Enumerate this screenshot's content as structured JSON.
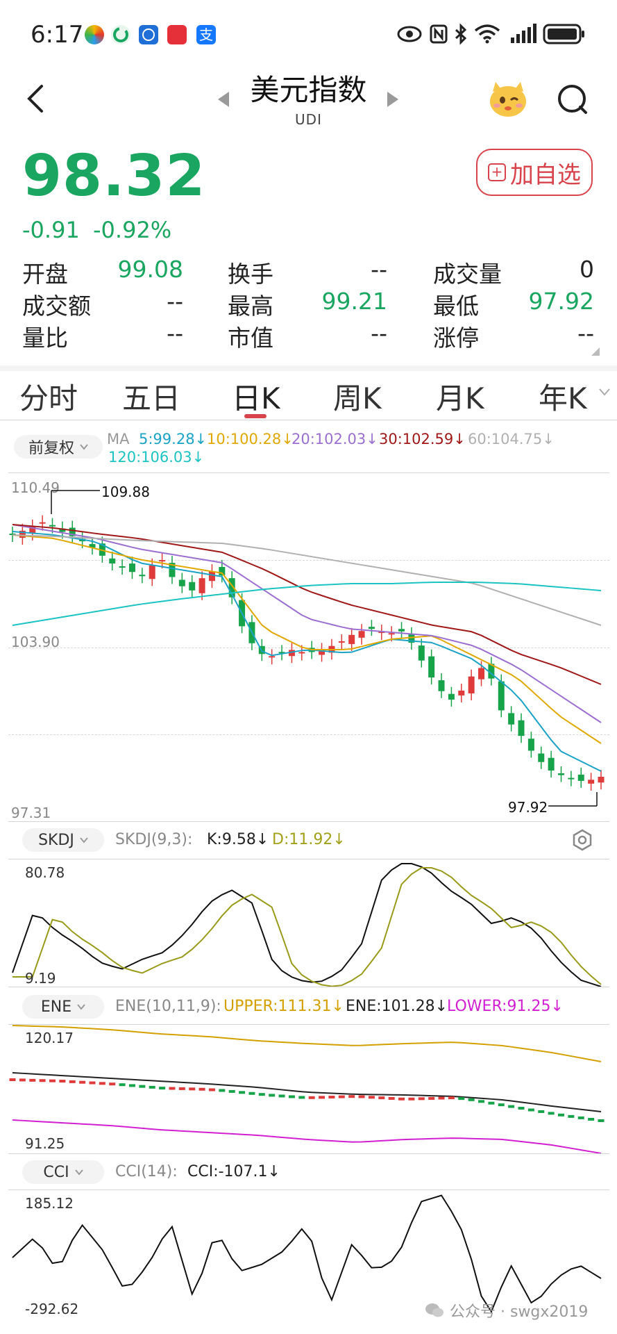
{
  "status_bar": {
    "time": "6:17"
  },
  "header": {
    "title": "美元指数",
    "code": "UDI"
  },
  "quote": {
    "price": "98.32",
    "change": "-0.91",
    "change_pct": "-0.92%",
    "add_button": "加自选",
    "stats": [
      {
        "label": "开盘",
        "value": "99.08",
        "color": "green"
      },
      {
        "label": "换手",
        "value": "--",
        "color": "dark"
      },
      {
        "label": "成交量",
        "value": "0",
        "color": "dark"
      },
      {
        "label": "成交额",
        "value": "--",
        "color": "dark"
      },
      {
        "label": "最高",
        "value": "99.21",
        "color": "green"
      },
      {
        "label": "最低",
        "value": "97.92",
        "color": "green"
      },
      {
        "label": "量比",
        "value": "--",
        "color": "dark"
      },
      {
        "label": "市值",
        "value": "--",
        "color": "dark"
      },
      {
        "label": "涨停",
        "value": "--",
        "color": "dark"
      }
    ]
  },
  "tabs": [
    "分时",
    "五日",
    "日K",
    "周K",
    "月K",
    "年K"
  ],
  "active_tab": "日K",
  "main_chart": {
    "adjust_label": "前复权",
    "ma_label": "MA",
    "ma_items": [
      {
        "text": "5:99.28↓",
        "color": "#1ba3c6"
      },
      {
        "text": "10:100.28↓",
        "color": "#e0a800"
      },
      {
        "text": "20:102.03↓",
        "color": "#9b6fd0"
      },
      {
        "text": "30:102.59↓",
        "color": "#a01818"
      },
      {
        "text": "60:104.75↓",
        "color": "#b0b0b0"
      },
      {
        "text": "120:106.03↓",
        "color": "#1cc3c3"
      }
    ],
    "y_top": "110.49",
    "y_mid": "103.90",
    "y_bottom": "97.31",
    "high_marker": "109.88",
    "low_marker": "97.92"
  },
  "skdj": {
    "name": "SKDJ",
    "params": "SKDJ(9,3):",
    "k": "K:9.58↓",
    "d": "D:11.92↓",
    "y_top": "80.78",
    "y_bottom": "9.19"
  },
  "ene": {
    "name": "ENE",
    "params": "ENE(10,11,9):",
    "upper": "UPPER:111.31↓",
    "ene": "ENE:101.28↓",
    "lower": "LOWER:91.25↓",
    "y_top": "120.17",
    "y_bottom": "91.25"
  },
  "cci": {
    "name": "CCI",
    "params": "CCI(14):",
    "value": "CCI:-107.1↓",
    "y_top": "185.12",
    "y_bottom": "-292.62"
  },
  "watermark": "公众号 · swgx2019",
  "colors": {
    "up": "#e03b3b",
    "down": "#16a34a",
    "accent": "#d9434b",
    "price_green": "#1aa660"
  },
  "chart_data": {
    "type": "candlestick",
    "title": "",
    "ylim": [
      97.31,
      110.49
    ],
    "series": [
      {
        "name": "MA5",
        "values": [
          99.28
        ]
      },
      {
        "name": "MA10",
        "values": [
          100.28
        ]
      },
      {
        "name": "MA20",
        "values": [
          102.03
        ]
      },
      {
        "name": "MA30",
        "values": [
          102.59
        ]
      },
      {
        "name": "MA60",
        "values": [
          104.75
        ]
      },
      {
        "name": "MA120",
        "values": [
          106.03
        ]
      }
    ]
  }
}
